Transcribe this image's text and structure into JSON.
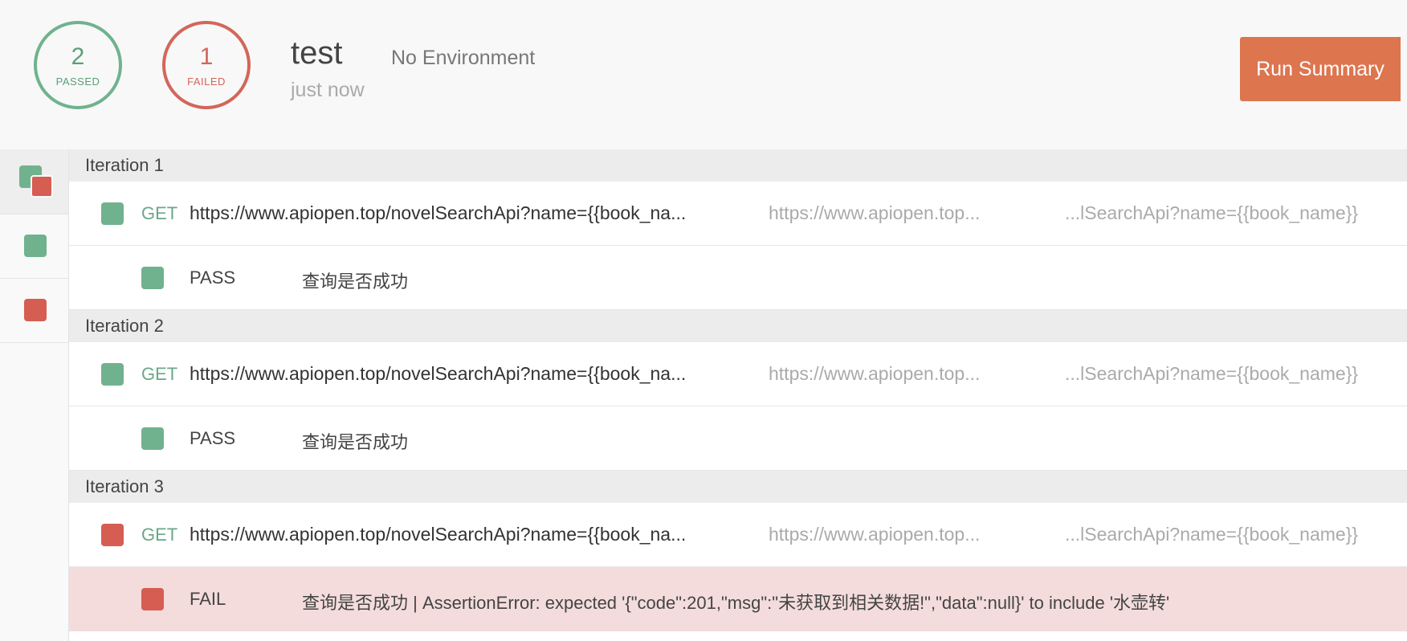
{
  "summary": {
    "passed_count": "2",
    "passed_label": "PASSED",
    "failed_count": "1",
    "failed_label": "FAILED",
    "title": "test",
    "environment": "No Environment",
    "time": "just now",
    "run_summary_button": "Run Summary"
  },
  "colors": {
    "pass": "#70b28e",
    "fail": "#d65d52",
    "accent": "#dd754f"
  },
  "iterations": [
    {
      "label": "Iteration 1",
      "request": {
        "status": "pass",
        "method": "GET",
        "url": "https://www.apiopen.top/novelSearchApi?name={{book_na...",
        "url_short": "https://www.apiopen.top...",
        "url_tail": "...lSearchApi?name={{book_name}}"
      },
      "test": {
        "status": "pass",
        "result": "PASS",
        "text": "查询是否成功"
      }
    },
    {
      "label": "Iteration 2",
      "request": {
        "status": "pass",
        "method": "GET",
        "url": "https://www.apiopen.top/novelSearchApi?name={{book_na...",
        "url_short": "https://www.apiopen.top...",
        "url_tail": "...lSearchApi?name={{book_name}}"
      },
      "test": {
        "status": "pass",
        "result": "PASS",
        "text": "查询是否成功"
      }
    },
    {
      "label": "Iteration 3",
      "request": {
        "status": "fail",
        "method": "GET",
        "url": "https://www.apiopen.top/novelSearchApi?name={{book_na...",
        "url_short": "https://www.apiopen.top...",
        "url_tail": "...lSearchApi?name={{book_name}}"
      },
      "test": {
        "status": "fail",
        "result": "FAIL",
        "text": "查询是否成功 | AssertionError: expected '{\"code\":201,\"msg\":\"未获取到相关数据!\",\"data\":null}' to include '水壶转'"
      }
    }
  ],
  "sidebar": {
    "items": [
      {
        "status": "mixed"
      },
      {
        "status": "pass"
      },
      {
        "status": "fail"
      }
    ]
  }
}
